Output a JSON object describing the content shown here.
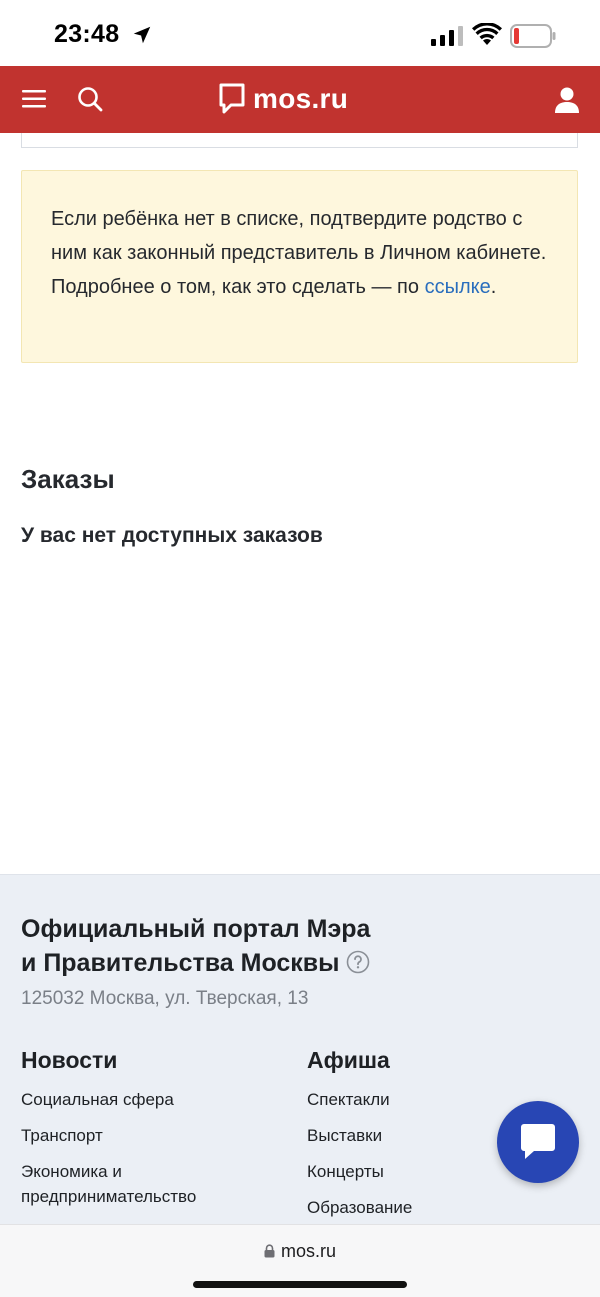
{
  "status_bar": {
    "time": "23:48",
    "icons": [
      "location-arrow-icon",
      "cellular-signal-icon",
      "wifi-icon",
      "battery-low-icon"
    ],
    "battery_color": "#e53935"
  },
  "header": {
    "background": "#c1332f",
    "logo_text": "mos.ru",
    "icons": [
      "hamburger-menu-icon",
      "search-icon",
      "chat-bubble-logo-icon",
      "user-icon"
    ]
  },
  "notice": {
    "text": "Если ребёнка нет в списке, подтвердите родство с ним как законный представитель в Личном кабинете. Подробнее о том, как это сделать — по ",
    "link": "ссылке",
    "end": ".",
    "background": "#fef7dd",
    "link_color": "#2a6ebd"
  },
  "orders": {
    "title": "Заказы",
    "empty": "У вас нет доступных заказов"
  },
  "footer": {
    "title_line1": "Официальный портал Мэра",
    "title_line2": "и Правительства Москвы",
    "address": "125032 Москва, ул. Тверская, 13",
    "news": {
      "heading": "Новости",
      "items": [
        "Социальная сфера",
        "Транспорт",
        "Экономика и предпринимательство"
      ]
    },
    "afisha": {
      "heading": "Афиша",
      "items": [
        "Спектакли",
        "Выставки",
        "Концерты",
        "Образование"
      ]
    }
  },
  "chat_button": {
    "color": "#2846b4",
    "icon": "chat-icon"
  },
  "browser": {
    "url": "mos.ru"
  }
}
